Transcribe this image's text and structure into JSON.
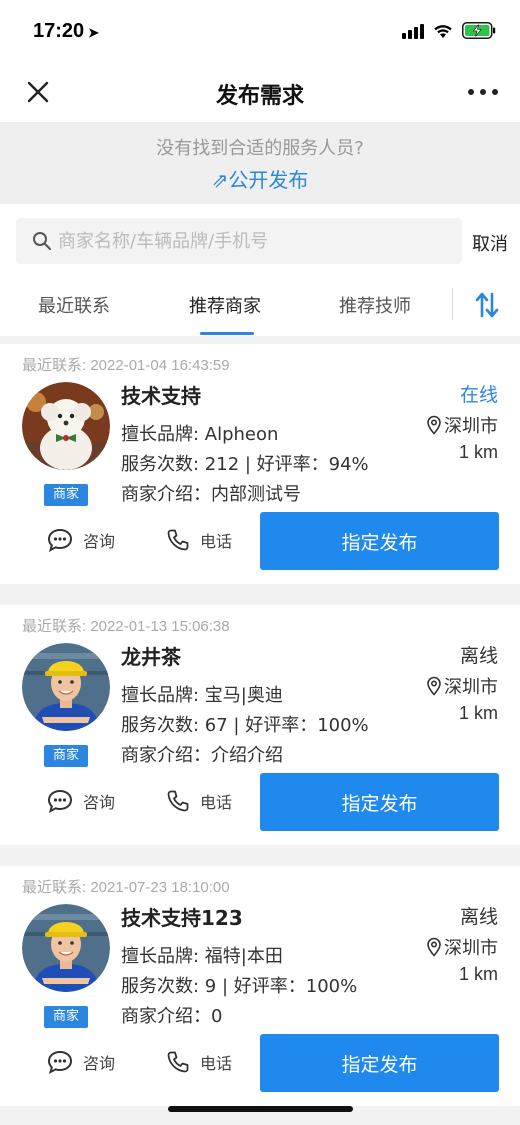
{
  "status_bar": {
    "time": "17:20"
  },
  "nav": {
    "title": "发布需求"
  },
  "banner": {
    "hint": "没有找到合适的服务人员?",
    "link": "⇗公开发布"
  },
  "search": {
    "placeholder": "商家名称/车辆品牌/手机号",
    "value": "",
    "cancel": "取消"
  },
  "tabs": [
    {
      "label": "最近联系",
      "active": false
    },
    {
      "label": "推荐商家",
      "active": true
    },
    {
      "label": "推荐技师",
      "active": false
    }
  ],
  "colors": {
    "accent": "#2089ee",
    "online": "#2c86e0",
    "offline": "#333333"
  },
  "cards": [
    {
      "date": "最近联系: 2022-01-04 16:43:59",
      "name": "技术支持",
      "status": "在线",
      "brand": "擅长品牌: Alpheon",
      "stats": "服务次数: 212 | 好评率：94%",
      "intro": "商家介绍：内部测试号",
      "city": "深圳市",
      "distance": "1 km",
      "badge": "商家",
      "avatar": "dog-avatar",
      "consult": "咨询",
      "phone": "电话",
      "assign": "指定发布"
    },
    {
      "date": "最近联系: 2022-01-13 15:06:38",
      "name": "龙井茶",
      "status": "离线",
      "brand": "擅长品牌: 宝马|奥迪",
      "stats": "服务次数: 67 | 好评率：100%",
      "intro": "商家介绍：介绍介绍",
      "city": "深圳市",
      "distance": "1 km",
      "badge": "商家",
      "avatar": "worker-avatar",
      "consult": "咨询",
      "phone": "电话",
      "assign": "指定发布"
    },
    {
      "date": "最近联系: 2021-07-23 18:10:00",
      "name": "技术支持123",
      "status": "离线",
      "brand": "擅长品牌: 福特|本田",
      "stats": "服务次数: 9 | 好评率：100%",
      "intro": "商家介绍：0",
      "city": "深圳市",
      "distance": "1 km",
      "badge": "商家",
      "avatar": "worker-avatar",
      "consult": "咨询",
      "phone": "电话",
      "assign": "指定发布"
    }
  ]
}
